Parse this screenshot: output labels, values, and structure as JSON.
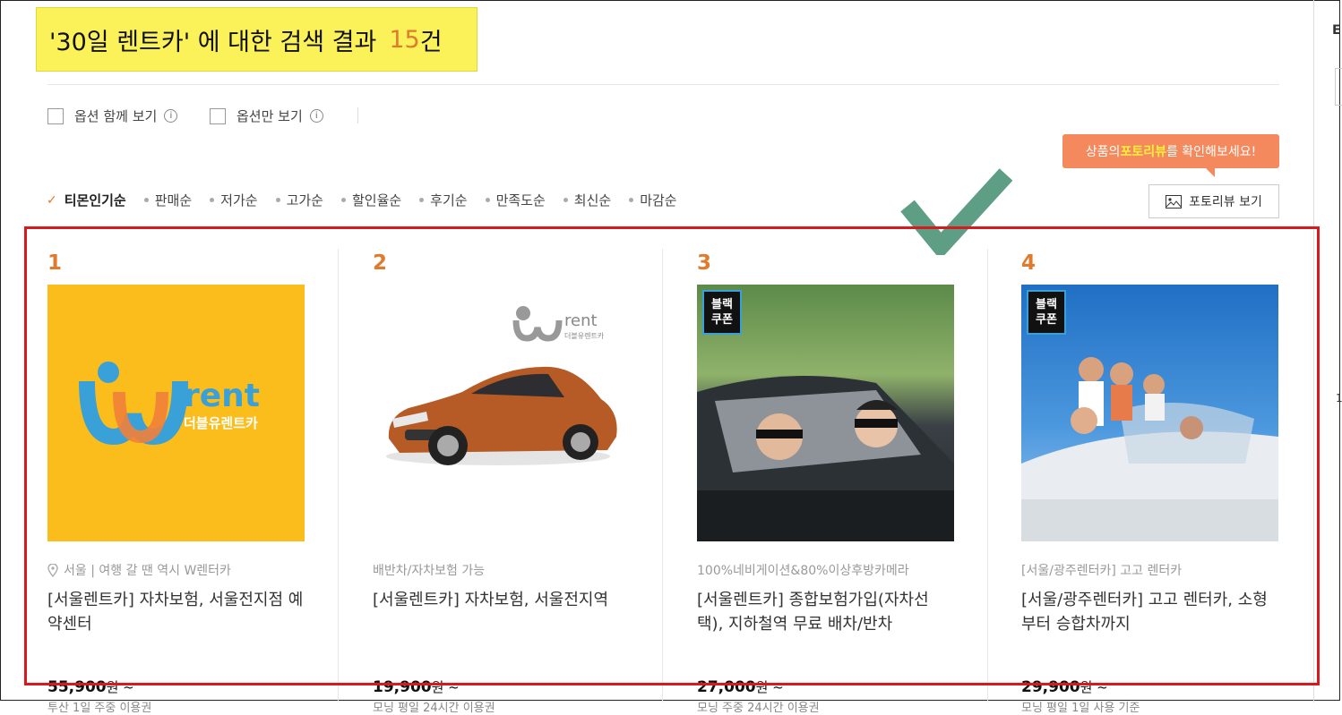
{
  "search": {
    "title_prefix": "'30일 렌트카' 에 대한 검색 결과",
    "count": "15",
    "count_unit": "건"
  },
  "options": [
    {
      "label": "옵션 함께 보기",
      "info": "i"
    },
    {
      "label": "옵션만 보기",
      "info": "i"
    }
  ],
  "tooltip": {
    "pre": "상품의 ",
    "highlight": "포토리뷰",
    "post": "를 확인해보세요!"
  },
  "sort": {
    "items": [
      "티몬인기순",
      "판매순",
      "저가순",
      "고가순",
      "할인율순",
      "후기순",
      "만족도순",
      "최신순",
      "마감순"
    ]
  },
  "photo_review_button": "포토리뷰 보기",
  "products": [
    {
      "rank": "1",
      "subline": "서울 | 여행 갈 땐 역시 W렌터카",
      "title": "[서울렌트카] 자차보험, 서울전지점 예약센터",
      "price": "55,900",
      "price_unit": "원 ~",
      "usage": "투산 1일 주중 이용권",
      "logo_text": "rent",
      "logo_sub": "더블유렌트카"
    },
    {
      "rank": "2",
      "subline": "배반차/자차보험 가능",
      "title": "[서울렌트카] 자차보험, 서울전지역",
      "price": "19,900",
      "price_unit": "원 ~",
      "usage": "모닝 평일 24시간 이용권",
      "logo_text": "rent",
      "logo_sub": "더블유렌트카"
    },
    {
      "rank": "3",
      "subline": "100%네비게이션&80%이상후방카메라",
      "title": "[서울렌트카] 종합보험가입(자차선택), 지하철역 무료 배차/반차",
      "price": "27,000",
      "price_unit": "원 ~",
      "usage": "모닝 주중 24시간 이용권",
      "badge": "블랙\n쿠폰"
    },
    {
      "rank": "4",
      "subline": "[서울/광주렌터카] 고고 렌터카",
      "title": "[서울/광주렌터카] 고고 렌터카, 소형부터 승합차까지",
      "price": "29,900",
      "price_unit": "원 ~",
      "usage": "모닝 평일 1일 사용 기준",
      "badge": "블랙\n쿠폰"
    }
  ],
  "right_panel": {
    "heading_char": "E",
    "digit": "1"
  },
  "colors": {
    "accent_orange": "#e07a2c",
    "title_highlight": "#fbf25a",
    "tooltip_bg": "#f4895e",
    "annotation_red": "#d71920",
    "check_green": "#5e9e85",
    "logo_yellow": "#fbbd1c"
  }
}
